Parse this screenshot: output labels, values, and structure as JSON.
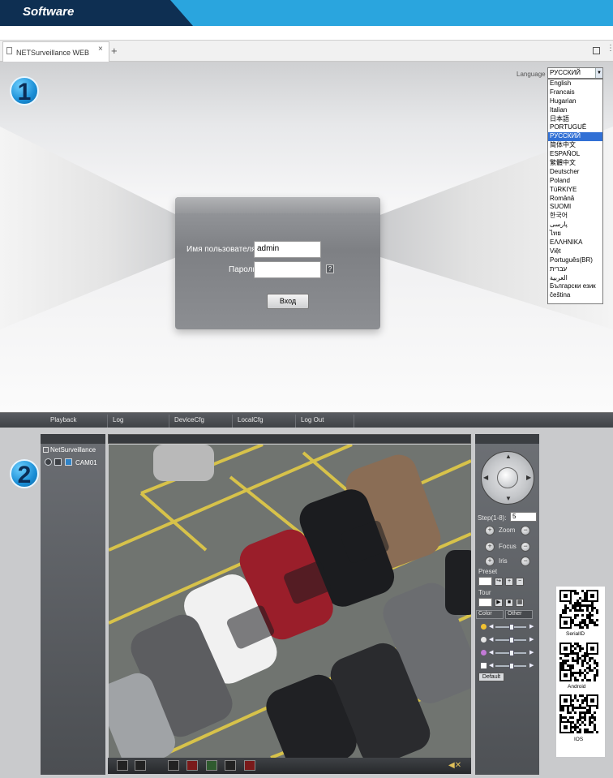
{
  "banner": {
    "title": "Software"
  },
  "browser": {
    "tab_title": "NETSurveillance WEB",
    "tab_close": "×",
    "new_tab": "+"
  },
  "step_markers": {
    "one": "1",
    "two": "2"
  },
  "language": {
    "label": "Language",
    "selected": "РУССКИЙ",
    "options": [
      "English",
      "Francais",
      "Hugarian",
      "Italian",
      "日本語",
      "PORTUGUÊ",
      "РУССКИЙ",
      "简体中文",
      "ESPAÑOL",
      "繁體中文",
      "Deutscher",
      "Poland",
      "TüRKIYE",
      "Română",
      "SUOMI",
      "한국어",
      "پارسی",
      "ไทย",
      "ΕΛΛΗΝΙΚΑ",
      "Việt",
      "Português(BR)",
      "עברית",
      "العربية",
      "Български език",
      "čeština"
    ]
  },
  "login": {
    "username_label": "Имя пользователя",
    "username_value": "admin",
    "password_label": "Пароль",
    "help": "?",
    "submit": "Вход"
  },
  "nav": {
    "items": [
      "Playback",
      "Log",
      "DeviceCfg",
      "LocalCfg",
      "Log Out"
    ]
  },
  "device_tree": {
    "root": "NetSurveillance",
    "camera": "CAM01"
  },
  "ptz": {
    "speed_label": "Step(1-8):",
    "speed_value": "5",
    "zoom": "Zoom",
    "focus": "Focus",
    "iris": "Iris",
    "preset_label": "Preset",
    "tour_label": "Tour",
    "color_tab": "Color",
    "other_tab": "Other",
    "default_button": "Default"
  },
  "qr_codes": {
    "serial": "SerialID",
    "android": "Android",
    "ios": "IOS"
  },
  "colors": {
    "banner": "#2aa5de",
    "banner_dark": "#0e2f52",
    "selected_lang": "#3170d5"
  }
}
